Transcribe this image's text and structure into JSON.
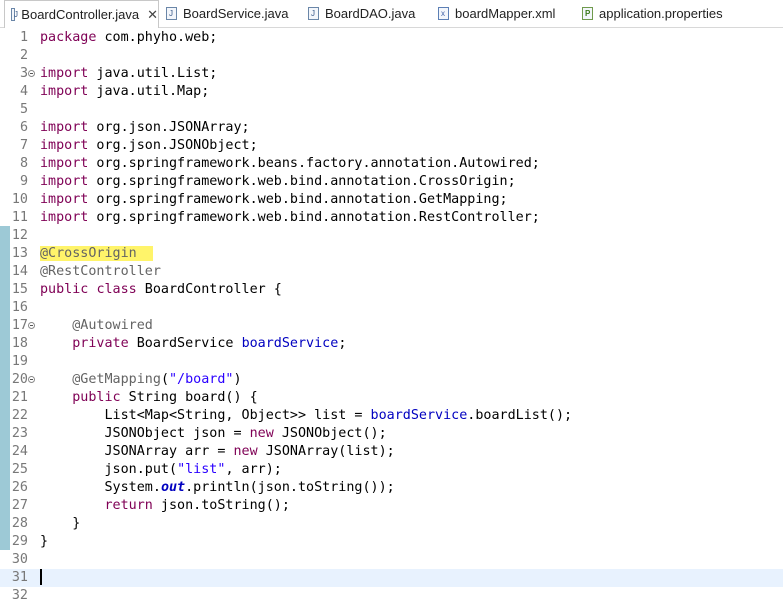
{
  "tabs": [
    {
      "label": "BoardController.java",
      "icon": "java-file-icon",
      "active": true,
      "close": "✕"
    },
    {
      "label": "BoardService.java",
      "icon": "java-file-icon"
    },
    {
      "label": "BoardDAO.java",
      "icon": "java-file-icon"
    },
    {
      "label": "boardMapper.xml",
      "icon": "xml-file-icon"
    },
    {
      "label": "application.properties",
      "icon": "properties-file-icon"
    }
  ],
  "editor": {
    "lines": [
      {
        "n": "1",
        "tokens": [
          {
            "t": "package",
            "k": "kw"
          },
          {
            "t": " com.phyho.web;"
          }
        ]
      },
      {
        "n": "2",
        "tokens": []
      },
      {
        "n": "3",
        "fold": true,
        "tokens": [
          {
            "t": "import",
            "k": "kw"
          },
          {
            "t": " java.util.List;"
          }
        ]
      },
      {
        "n": "4",
        "tokens": [
          {
            "t": "import",
            "k": "kw"
          },
          {
            "t": " java.util.Map;"
          }
        ]
      },
      {
        "n": "5",
        "tokens": []
      },
      {
        "n": "6",
        "tokens": [
          {
            "t": "import",
            "k": "kw"
          },
          {
            "t": " org.json.JSONArray;"
          }
        ]
      },
      {
        "n": "7",
        "tokens": [
          {
            "t": "import",
            "k": "kw"
          },
          {
            "t": " org.json.JSONObject;"
          }
        ]
      },
      {
        "n": "8",
        "tokens": [
          {
            "t": "import",
            "k": "kw"
          },
          {
            "t": " org.springframework.beans.factory.annotation.Autowired;"
          }
        ]
      },
      {
        "n": "9",
        "tokens": [
          {
            "t": "import",
            "k": "kw"
          },
          {
            "t": " org.springframework.web.bind.annotation.CrossOrigin;"
          }
        ]
      },
      {
        "n": "10",
        "tokens": [
          {
            "t": "import",
            "k": "kw"
          },
          {
            "t": " org.springframework.web.bind.annotation.GetMapping;"
          }
        ]
      },
      {
        "n": "11",
        "tokens": [
          {
            "t": "import",
            "k": "kw"
          },
          {
            "t": " org.springframework.web.bind.annotation.RestController;"
          }
        ]
      },
      {
        "n": "12",
        "tokens": []
      },
      {
        "n": "13",
        "tokens": [
          {
            "t": "@CrossOrigin",
            "k": "ann hl"
          },
          {
            "t": "  ",
            "k": "hl"
          }
        ]
      },
      {
        "n": "14",
        "tokens": [
          {
            "t": "@RestController",
            "k": "ann"
          }
        ]
      },
      {
        "n": "15",
        "tokens": [
          {
            "t": "public",
            "k": "kw"
          },
          {
            "t": " "
          },
          {
            "t": "class",
            "k": "kw"
          },
          {
            "t": " BoardController {"
          }
        ]
      },
      {
        "n": "16",
        "tokens": []
      },
      {
        "n": "17",
        "fold": true,
        "tokens": [
          {
            "t": "    "
          },
          {
            "t": "@Autowired",
            "k": "ann"
          }
        ]
      },
      {
        "n": "18",
        "tokens": [
          {
            "t": "    "
          },
          {
            "t": "private",
            "k": "kw"
          },
          {
            "t": " BoardService "
          },
          {
            "t": "boardService",
            "k": "fld"
          },
          {
            "t": ";"
          }
        ]
      },
      {
        "n": "19",
        "tokens": []
      },
      {
        "n": "20",
        "fold": true,
        "tokens": [
          {
            "t": "    "
          },
          {
            "t": "@GetMapping",
            "k": "ann"
          },
          {
            "t": "("
          },
          {
            "t": "\"/board\"",
            "k": "str"
          },
          {
            "t": ")"
          }
        ]
      },
      {
        "n": "21",
        "tokens": [
          {
            "t": "    "
          },
          {
            "t": "public",
            "k": "kw"
          },
          {
            "t": " String board() {"
          }
        ]
      },
      {
        "n": "22",
        "tokens": [
          {
            "t": "        List<Map<String, Object>> list = "
          },
          {
            "t": "boardService",
            "k": "fld"
          },
          {
            "t": ".boardList();"
          }
        ]
      },
      {
        "n": "23",
        "tokens": [
          {
            "t": "        JSONObject json = "
          },
          {
            "t": "new",
            "k": "kw"
          },
          {
            "t": " JSONObject();"
          }
        ]
      },
      {
        "n": "24",
        "tokens": [
          {
            "t": "        JSONArray arr = "
          },
          {
            "t": "new",
            "k": "kw"
          },
          {
            "t": " JSONArray(list);"
          }
        ]
      },
      {
        "n": "25",
        "tokens": [
          {
            "t": "        json.put("
          },
          {
            "t": "\"list\"",
            "k": "str"
          },
          {
            "t": ", arr);"
          }
        ]
      },
      {
        "n": "26",
        "tokens": [
          {
            "t": "        System."
          },
          {
            "t": "out",
            "k": "st"
          },
          {
            "t": ".println(json.toString());"
          }
        ]
      },
      {
        "n": "27",
        "tokens": [
          {
            "t": "        "
          },
          {
            "t": "return",
            "k": "kw"
          },
          {
            "t": " json.toString();"
          }
        ]
      },
      {
        "n": "28",
        "tokens": [
          {
            "t": "    }"
          }
        ]
      },
      {
        "n": "29",
        "tokens": [
          {
            "t": "}"
          }
        ]
      },
      {
        "n": "30",
        "tokens": []
      },
      {
        "n": "31",
        "current": true,
        "tokens": []
      },
      {
        "n": "32",
        "tokens": []
      }
    ]
  },
  "colors": {
    "keyword": "#7f0055",
    "annotation": "#646464",
    "field": "#0000c0",
    "string": "#2a00ff",
    "highlight": "#fff46a",
    "current_line": "#e8f2fe",
    "change_marker": "#4d9db5"
  }
}
